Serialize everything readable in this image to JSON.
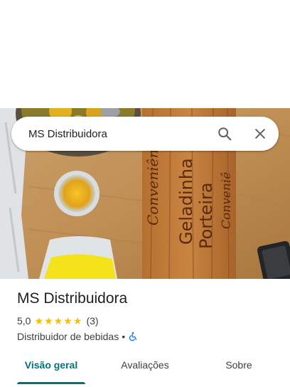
{
  "search": {
    "query": "MS Distribuidora"
  },
  "icons": {
    "search": "search-icon",
    "close": "close-icon",
    "star": "star-icon",
    "accessibility": "wheelchair-icon"
  },
  "place": {
    "name": "MS Distribuidora",
    "rating": "5,0",
    "stars": 5,
    "review_count": "(3)",
    "category": "Distribuidor de bebidas",
    "separator": "•"
  },
  "photo": {
    "sign_words": [
      "Conveniência",
      "Geladinha",
      "Porteira",
      "Conveniê"
    ]
  },
  "tabs": [
    {
      "label": "Visão geral",
      "active": true
    },
    {
      "label": "Avaliações",
      "active": false
    },
    {
      "label": "Sobre",
      "active": false
    }
  ],
  "colors": {
    "accent": "#00737d",
    "star": "#fbbc04",
    "text": "#202124",
    "secondary": "#3c4043"
  }
}
